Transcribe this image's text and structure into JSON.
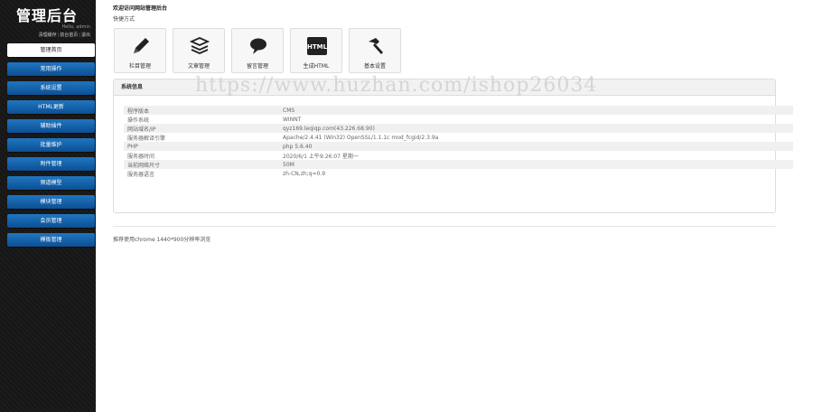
{
  "sidebar": {
    "logo": "管理后台",
    "hello": "Hello, admin",
    "user_links": [
      "清理缓存",
      "前台首页",
      "退出"
    ],
    "nav": [
      {
        "label": "管理首页",
        "active": true
      },
      {
        "label": "常用操作",
        "active": false
      },
      {
        "label": "系统设置",
        "active": false
      },
      {
        "label": "HTML更新",
        "active": false
      },
      {
        "label": "辅助插件",
        "active": false
      },
      {
        "label": "批量维护",
        "active": false
      },
      {
        "label": "附件管理",
        "active": false
      },
      {
        "label": "频道模型",
        "active": false
      },
      {
        "label": "模块管理",
        "active": false
      },
      {
        "label": "会员管理",
        "active": false
      },
      {
        "label": "模板管理",
        "active": false
      }
    ]
  },
  "main": {
    "welcome": "欢迎访问网站管理后台",
    "shortcut_title": "快捷方式",
    "shortcuts": [
      {
        "label": "栏目管理",
        "icon": "pencil-icon"
      },
      {
        "label": "文章管理",
        "icon": "stack-icon"
      },
      {
        "label": "留言管理",
        "icon": "chat-bubble-icon"
      },
      {
        "label": "生成HTML",
        "icon": "html-icon"
      },
      {
        "label": "基本设置",
        "icon": "hammer-icon"
      }
    ],
    "html_icon_text": "HTML",
    "watermark": "https://www.huzhan.com/ishop26034",
    "system_info": {
      "title": "系统信息",
      "rows": [
        {
          "key": "程序版本",
          "value": "CMS"
        },
        {
          "key": "操作系统",
          "value": "WINNT"
        },
        {
          "key": "网站域名/IP",
          "value": "qyz169.leqiqp.com(43.226.68.90)"
        },
        {
          "key": "服务器解译引擎",
          "value": "Apache/2.4.41 (Win32) OpenSSL/1.1.1c mod_fcgid/2.3.9a"
        },
        {
          "key": "PHP",
          "value": "php 5.6.40"
        },
        {
          "key": "服务器时间",
          "value": "2020/6/1 上午9:26:07 星期一"
        },
        {
          "key": "当前网络尺寸",
          "value": "50M"
        },
        {
          "key": "服务器语言",
          "value": "zh-CN,zh;q=0.9"
        }
      ]
    },
    "footer": "推荐使用chrome 1440*900分辨率浏览"
  },
  "colors": {
    "sidebar_bg": "#1a1a1a",
    "nav_blue": "#1565b0",
    "panel_head_bg": "#f2f2f2"
  }
}
